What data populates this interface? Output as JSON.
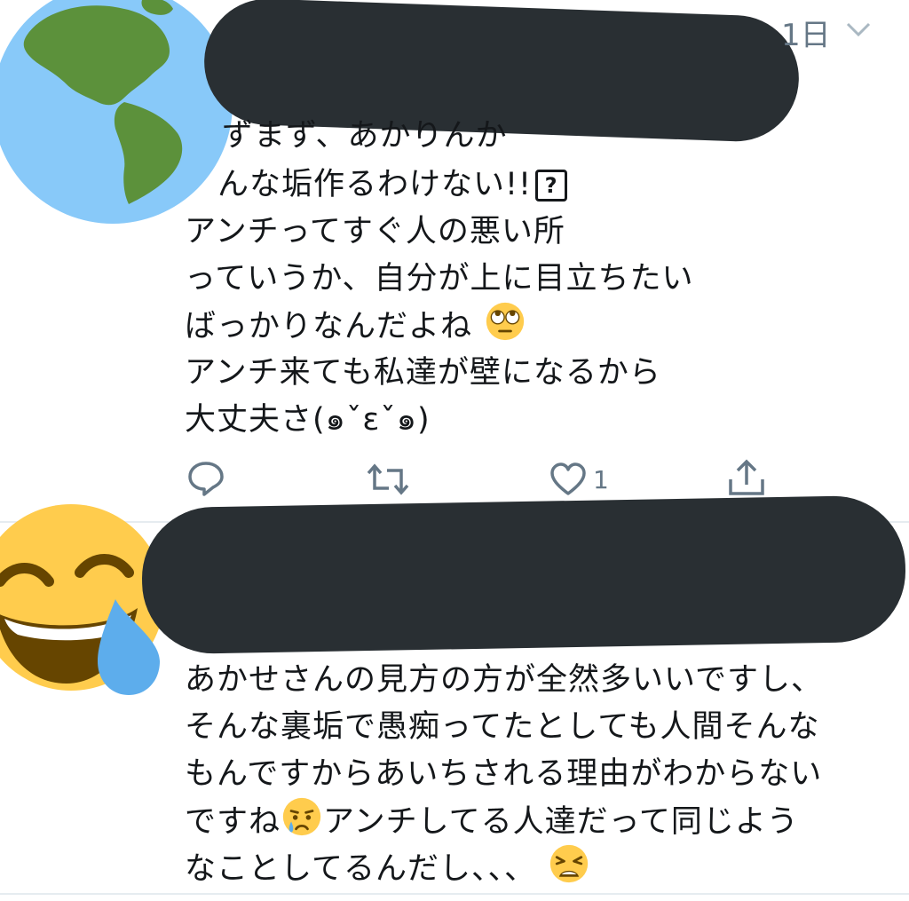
{
  "tweet1": {
    "timestamp": "1日",
    "lines": [
      "ずまず、あかりんか",
      "んな垢作るわけない!!",
      "アンチってすぐ人の悪い所",
      "っていうか、自分が上に目立ちたい",
      "ばっかりなんだよね",
      "アンチ来ても私達が壁になるから",
      "大丈夫さ(๑ˇεˇ๑)"
    ],
    "unknown_glyph": "?",
    "like_count": "1"
  },
  "tweet2": {
    "lines": [
      "あかせさんの見方の方が全然多いいですし、",
      "そんな裏垢で愚痴ってたとしても人間そんな",
      "もんですからあいちされる理由がわからない",
      "ですね",
      "アンチしてる人達だって同じよう",
      "なことしてるんだし、、、"
    ]
  },
  "icons": {
    "globe": "globe-americas-icon",
    "laughing": "tears-of-joy-emoji-icon",
    "reply": "reply-icon",
    "retweet": "retweet-icon",
    "like": "heart-icon",
    "share": "share-icon",
    "caret": "chevron-down-icon",
    "eyeroll": "face-rolling-eyes-emoji",
    "crying": "crying-face-emoji",
    "weary": "weary-face-emoji"
  },
  "colors": {
    "redaction": "#292f33",
    "action_gray": "#657786",
    "divider": "#e6ecf0",
    "text": "#14171a"
  }
}
